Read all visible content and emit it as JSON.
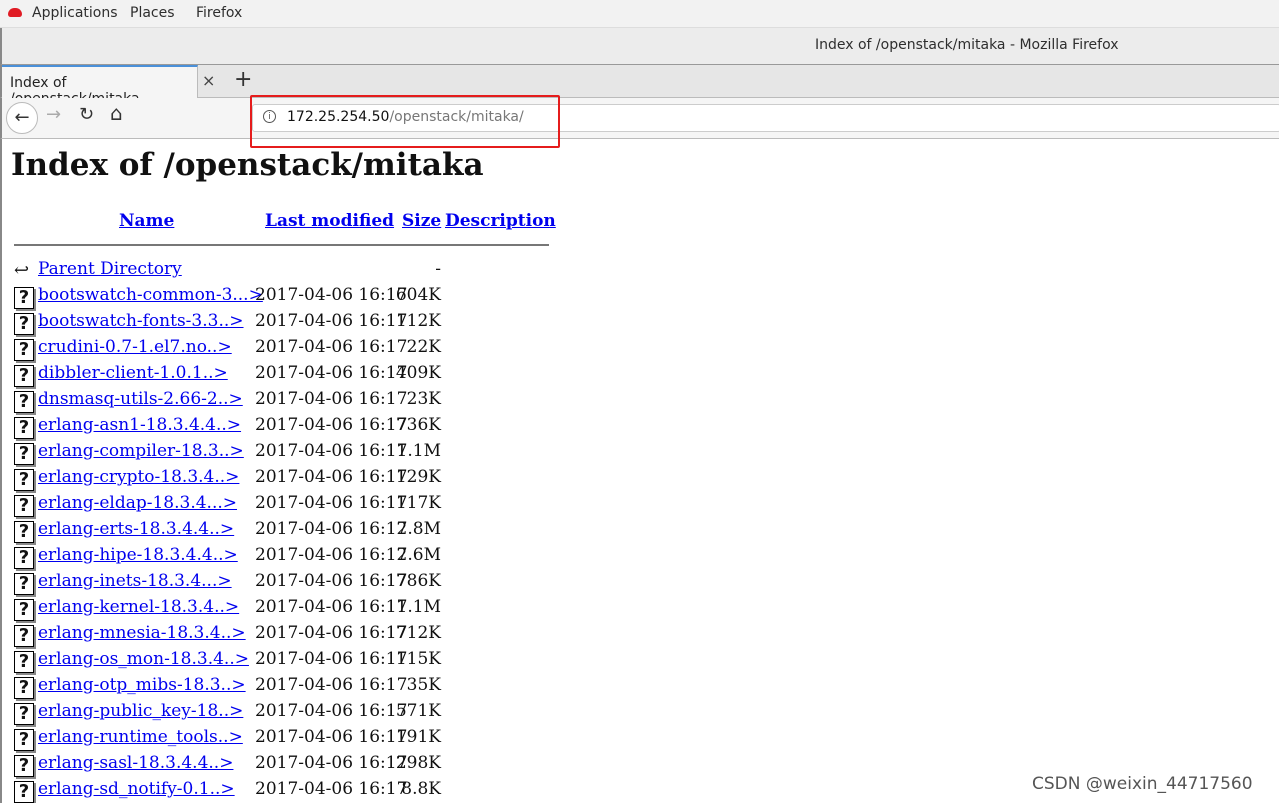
{
  "desktop": {
    "menus": [
      "Applications",
      "Places",
      "Firefox"
    ]
  },
  "window": {
    "title": "Index of /openstack/mitaka - Mozilla Firefox"
  },
  "tab": {
    "label": "Index of /openstack/mitaka",
    "close": "×",
    "new_tab": "+"
  },
  "nav": {
    "back": "←",
    "forward": "→",
    "reload": "↻",
    "home": "⌂",
    "info": "i",
    "url_host": "172.25.254.50",
    "url_path": "/openstack/mitaka/"
  },
  "highlight_color": "#e51c1c",
  "page": {
    "title": "Index of /openstack/mitaka",
    "headers": {
      "name": "Name",
      "modified": "Last modified",
      "size": "Size",
      "description": "Description"
    },
    "parent": {
      "name": "Parent Directory",
      "size": "-"
    },
    "files": [
      {
        "name": "bootswatch-common-3...>",
        "modified": "2017-04-06 16:17",
        "size": "604K"
      },
      {
        "name": "bootswatch-fonts-3.3..>",
        "modified": "2017-04-06 16:17",
        "size": "112K"
      },
      {
        "name": "crudini-0.7-1.el7.no..>",
        "modified": "2017-04-06 16:17",
        "size": "22K"
      },
      {
        "name": "dibbler-client-1.0.1..>",
        "modified": "2017-04-06 16:17",
        "size": "409K"
      },
      {
        "name": "dnsmasq-utils-2.66-2..>",
        "modified": "2017-04-06 16:17",
        "size": "23K"
      },
      {
        "name": "erlang-asn1-18.3.4.4..>",
        "modified": "2017-04-06 16:17",
        "size": "736K"
      },
      {
        "name": "erlang-compiler-18.3..>",
        "modified": "2017-04-06 16:17",
        "size": "1.1M"
      },
      {
        "name": "erlang-crypto-18.3.4..>",
        "modified": "2017-04-06 16:17",
        "size": "129K"
      },
      {
        "name": "erlang-eldap-18.3.4...>",
        "modified": "2017-04-06 16:17",
        "size": "117K"
      },
      {
        "name": "erlang-erts-18.3.4.4..>",
        "modified": "2017-04-06 16:17",
        "size": "2.8M"
      },
      {
        "name": "erlang-hipe-18.3.4.4..>",
        "modified": "2017-04-06 16:17",
        "size": "2.6M"
      },
      {
        "name": "erlang-inets-18.3.4...>",
        "modified": "2017-04-06 16:17",
        "size": "786K"
      },
      {
        "name": "erlang-kernel-18.3.4..>",
        "modified": "2017-04-06 16:17",
        "size": "1.1M"
      },
      {
        "name": "erlang-mnesia-18.3.4..>",
        "modified": "2017-04-06 16:17",
        "size": "712K"
      },
      {
        "name": "erlang-os_mon-18.3.4..>",
        "modified": "2017-04-06 16:17",
        "size": "115K"
      },
      {
        "name": "erlang-otp_mibs-18.3..>",
        "modified": "2017-04-06 16:17",
        "size": "35K"
      },
      {
        "name": "erlang-public_key-18..>",
        "modified": "2017-04-06 16:17",
        "size": "571K"
      },
      {
        "name": "erlang-runtime_tools..>",
        "modified": "2017-04-06 16:17",
        "size": "191K"
      },
      {
        "name": "erlang-sasl-18.3.4.4..>",
        "modified": "2017-04-06 16:17",
        "size": "298K"
      },
      {
        "name": "erlang-sd_notify-0.1..>",
        "modified": "2017-04-06 16:17",
        "size": "8.8K"
      }
    ]
  },
  "watermark": "CSDN @weixin_44717560"
}
